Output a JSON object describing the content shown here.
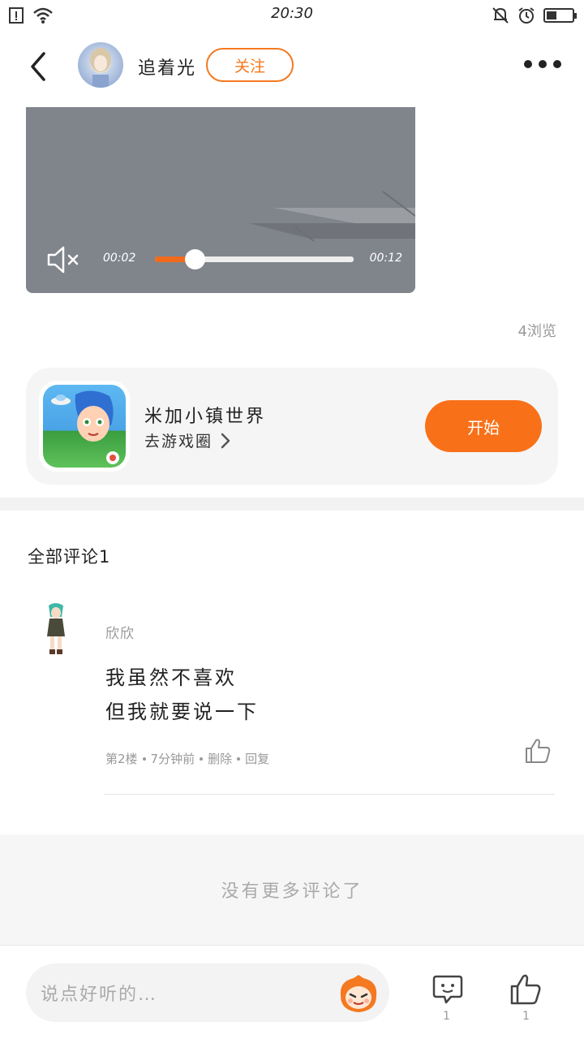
{
  "status_bar": {
    "time": "20:30",
    "battery_level": 0.4,
    "icons": [
      "notification-icon",
      "wifi-icon",
      "mute-bell-icon",
      "alarm-icon",
      "battery-icon"
    ]
  },
  "header": {
    "username": "追着光",
    "follow_label": "关注"
  },
  "video": {
    "current_time": "00:02",
    "total_time": "00:12",
    "progress": 0.2
  },
  "post": {
    "views": "4浏览"
  },
  "game_card": {
    "name": "米加小镇世界",
    "link_label": "去游戏圈",
    "start_label": "开始"
  },
  "comments": {
    "title": "全部评论1",
    "items": [
      {
        "user": "欣欣",
        "line1": "我虽然不喜欢",
        "line2": "但我就要说一下",
        "floor": "第2楼",
        "time": "7分钟前",
        "delete_label": "删除",
        "reply_label": "回复"
      }
    ],
    "no_more": "没有更多评论了"
  },
  "bottom_bar": {
    "input_placeholder": "说点好听的…",
    "comment_count": "1",
    "like_count": "1"
  },
  "colors": {
    "accent": "#f47920",
    "button": "#f87119",
    "video_bg": "#80848b"
  }
}
